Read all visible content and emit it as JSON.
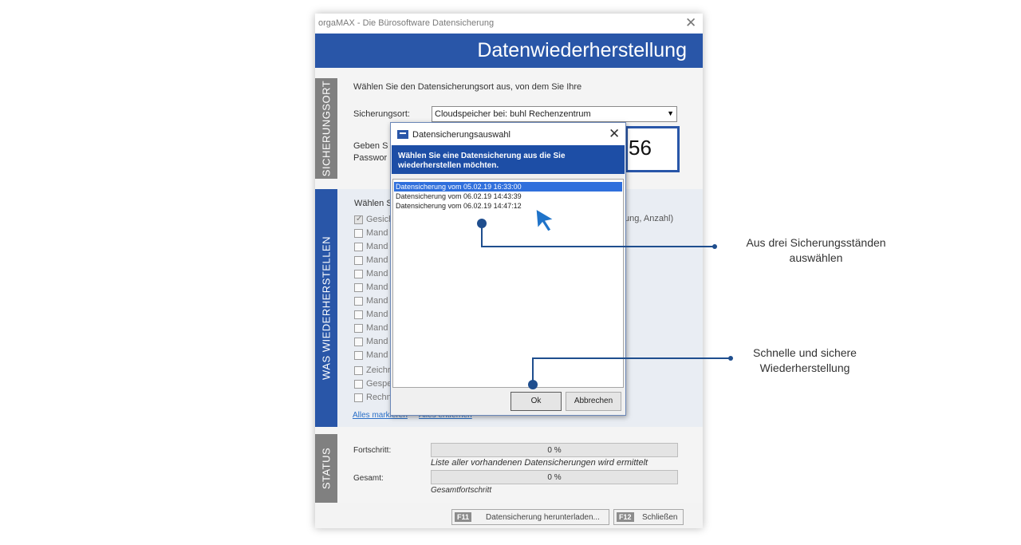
{
  "window": {
    "title": "orgaMAX - Die Bürosoftware Datensicherung",
    "close_icon": "✕"
  },
  "banner": {
    "title": "Datenwiederherstellung"
  },
  "side_tabs": {
    "sicherungsort": "SICHERUNGSORT",
    "was": "WAS WIEDERHERSTELLEN",
    "status": "STATUS"
  },
  "location": {
    "instruction": "Wählen Sie den Datensicherungsort aus, von dem Sie Ihre",
    "label": "Sicherungsort:",
    "value": "Cloudspeicher bei: buhl Rechenzentrum",
    "password_prompt_1": "Geben S",
    "password_prompt_2": "Passwor",
    "password_visible": "56"
  },
  "restore": {
    "instruction": "Wählen S",
    "count_hint": "ung, Anzahl)",
    "items": [
      {
        "label": "Gesich",
        "checked": true
      },
      {
        "label": "Mand",
        "checked": false
      },
      {
        "label": "Mand",
        "checked": false
      },
      {
        "label": "Mand",
        "checked": false
      },
      {
        "label": "Mand",
        "checked": false
      },
      {
        "label": "Mand",
        "checked": false
      },
      {
        "label": "Mand",
        "checked": false
      },
      {
        "label": "Mand",
        "checked": false
      },
      {
        "label": "Mand",
        "checked": false
      },
      {
        "label": "Mand",
        "checked": false
      },
      {
        "label": "Mand",
        "checked": false
      },
      {
        "label": "Zeichr",
        "checked": false
      },
      {
        "label": "Gespe",
        "checked": false
      },
      {
        "label": "Rechn",
        "checked": false
      }
    ],
    "mark_all": "Alles markieren",
    "unmark_all": "Alles entfernen"
  },
  "status": {
    "progress_label": "Fortschritt:",
    "progress_value": "0 %",
    "progress_caption": "Liste aller vorhandenen Datensicherungen wird ermittelt",
    "total_label": "Gesamt:",
    "total_value": "0 %",
    "total_caption": "Gesamtfortschritt"
  },
  "footer": {
    "download_key": "F11",
    "download_label": "Datensicherung herunterladen...",
    "close_key": "F12",
    "close_label": "Schließen"
  },
  "dialog": {
    "title": "Datensicherungsauswahl",
    "close_icon": "✕",
    "header_line1": "Wählen Sie eine Datensicherung aus die Sie",
    "header_line2": "wiederherstellen möchten.",
    "backups": [
      {
        "label": "Datensicherung vom 05.02.19 16:33:00",
        "selected": true
      },
      {
        "label": "Datensicherung vom 06.02.19 14:43:39",
        "selected": false
      },
      {
        "label": "Datensicherung vom 06.02.19 14:47:12",
        "selected": false
      }
    ],
    "ok_label": "Ok",
    "cancel_label": "Abbrechen"
  },
  "annotations": {
    "first_line1": "Aus drei Sicherungsständen",
    "first_line2": "auswählen",
    "second_line1": "Schnelle und sichere",
    "second_line2": "Wiederherstellung"
  },
  "colors": {
    "accent": "#2956a8",
    "callout": "#1f4e8e",
    "selection": "#2f6fdc"
  }
}
